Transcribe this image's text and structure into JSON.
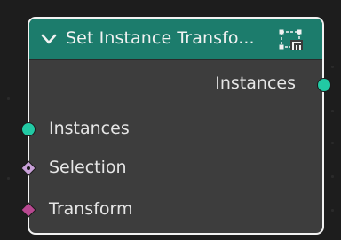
{
  "node": {
    "title": "Set Instance Transfo...",
    "header_color": "#1c7c6c",
    "body_color": "#3d3d3d",
    "border_color": "#f2f2f2",
    "collapse_icon": "chevron-down-icon",
    "header_icon": "transform-gizmo-icon"
  },
  "outputs": [
    {
      "label": "Instances",
      "socket_color": "#22c9a4",
      "socket_shape": "circle"
    }
  ],
  "inputs": [
    {
      "label": "Instances",
      "socket_color": "#22c9a4",
      "socket_shape": "circle"
    },
    {
      "label": "Selection",
      "socket_color": "#c8a0d8",
      "socket_shape": "diamond-dot"
    },
    {
      "label": "Transform",
      "socket_color": "#b84890",
      "socket_shape": "diamond"
    }
  ]
}
